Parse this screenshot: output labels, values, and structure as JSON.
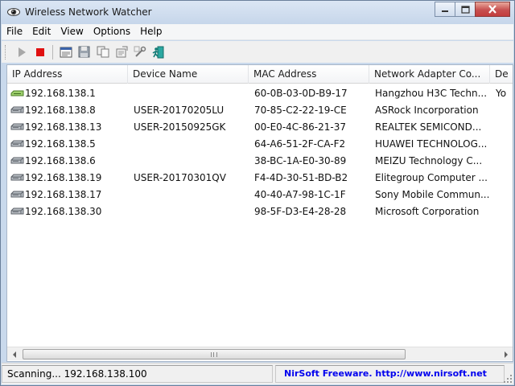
{
  "window": {
    "title": "Wireless Network Watcher",
    "icon": "eye-icon",
    "controls": [
      "minimize-icon",
      "maximize-icon",
      "close-icon"
    ]
  },
  "menu": [
    "File",
    "Edit",
    "View",
    "Options",
    "Help"
  ],
  "toolbar": {
    "buttons": [
      "start-scan-icon",
      "stop-scan-icon",
      "html-report-icon",
      "save-icon",
      "copy-icon",
      "properties-icon",
      "options-icon",
      "exit-icon"
    ]
  },
  "columns": [
    "IP Address",
    "Device Name",
    "MAC Address",
    "Network Adapter Co...",
    "De"
  ],
  "rows": [
    {
      "ip": "192.168.138.1",
      "device": "",
      "mac": "60-0B-03-0D-B9-17",
      "vendor": "Hangzhou H3C Techn...",
      "extra": "Yo",
      "icon": "router-icon"
    },
    {
      "ip": "192.168.138.8",
      "device": "USER-20170205LU",
      "mac": "70-85-C2-22-19-CE",
      "vendor": "ASRock Incorporation",
      "extra": "",
      "icon": "computer-icon"
    },
    {
      "ip": "192.168.138.13",
      "device": "USER-20150925GK",
      "mac": "00-E0-4C-86-21-37",
      "vendor": "REALTEK SEMICOND...",
      "extra": "",
      "icon": "computer-icon"
    },
    {
      "ip": "192.168.138.5",
      "device": "",
      "mac": "64-A6-51-2F-CA-F2",
      "vendor": "HUAWEI TECHNOLOG...",
      "extra": "",
      "icon": "computer-icon"
    },
    {
      "ip": "192.168.138.6",
      "device": "",
      "mac": "38-BC-1A-E0-30-89",
      "vendor": "MEIZU Technology C...",
      "extra": "",
      "icon": "computer-icon"
    },
    {
      "ip": "192.168.138.19",
      "device": "USER-20170301QV",
      "mac": "F4-4D-30-51-BD-B2",
      "vendor": "Elitegroup Computer ...",
      "extra": "",
      "icon": "computer-icon"
    },
    {
      "ip": "192.168.138.17",
      "device": "",
      "mac": "40-40-A7-98-1C-1F",
      "vendor": "Sony Mobile Commun...",
      "extra": "",
      "icon": "computer-icon"
    },
    {
      "ip": "192.168.138.30",
      "device": "",
      "mac": "98-5F-D3-E4-28-28",
      "vendor": "Microsoft Corporation",
      "extra": "",
      "icon": "computer-icon"
    }
  ],
  "status": {
    "scanning": "Scanning... 192.168.138.100",
    "credit": "NirSoft Freeware.  http://www.nirsoft.net"
  }
}
